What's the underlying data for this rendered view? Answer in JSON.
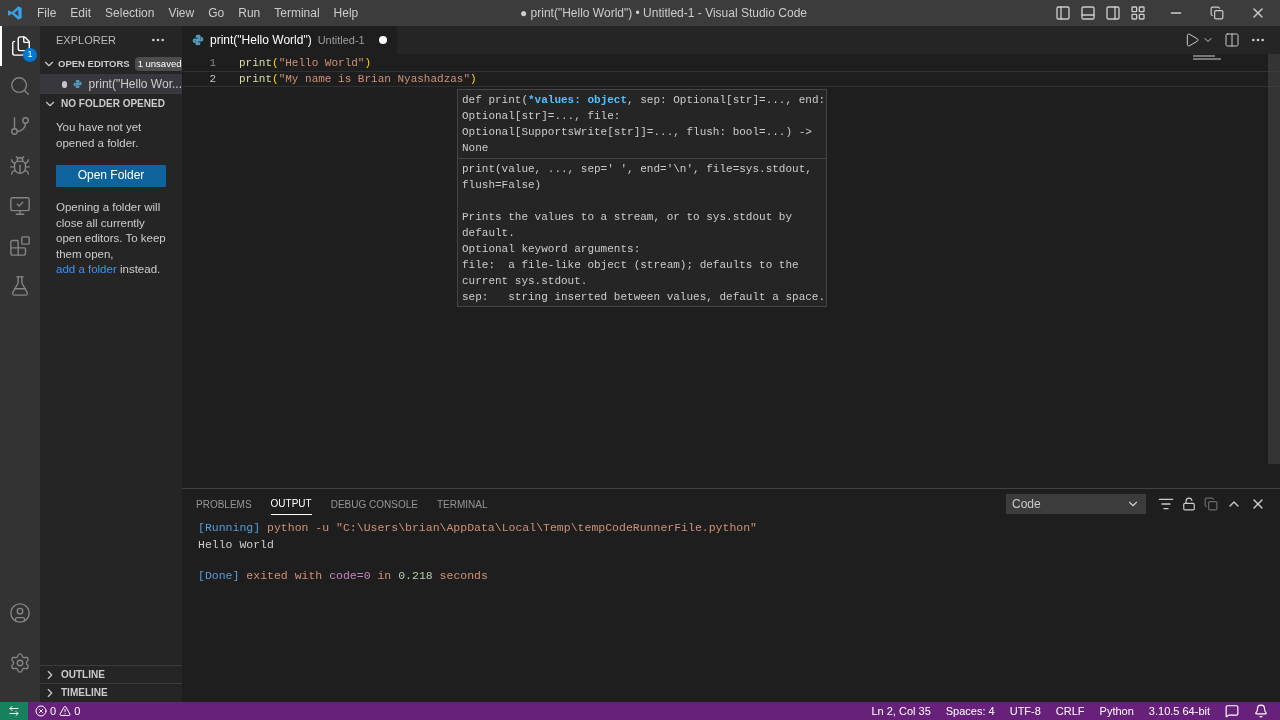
{
  "menu": [
    "File",
    "Edit",
    "Selection",
    "View",
    "Go",
    "Run",
    "Terminal",
    "Help"
  ],
  "window_title": "● print(\"Hello World\") • Untitled-1 - Visual Studio Code",
  "activity_bar": [
    {
      "kind": "files",
      "selected": true,
      "badge": "1"
    },
    {
      "kind": "search",
      "selected": false
    },
    {
      "kind": "source-control",
      "selected": false
    },
    {
      "kind": "run",
      "selected": false
    },
    {
      "kind": "remote",
      "selected": false
    },
    {
      "kind": "extensions",
      "selected": false
    },
    {
      "kind": "testing",
      "selected": false
    }
  ],
  "activity_bottom": [
    {
      "kind": "account"
    },
    {
      "kind": "settings"
    }
  ],
  "sidebar": {
    "title": "EXPLORER",
    "open_editors": {
      "label": "OPEN EDITORS",
      "expanded": true,
      "badge": "1 unsaved",
      "files": [
        {
          "name": "print(\"Hello Wor...",
          "modified": true
        }
      ]
    },
    "no_folder": {
      "label": "NO FOLDER OPENED",
      "expanded": true,
      "message": "You have not yet opened a folder.",
      "button": "Open Folder",
      "note_before": "Opening a folder will close all currently open editors. To keep them open,",
      "link": "add a folder",
      "note_after": "instead."
    },
    "outline": {
      "label": "OUTLINE",
      "expanded": false
    },
    "timeline": {
      "label": "TIMELINE",
      "expanded": false
    }
  },
  "editor_tab": {
    "title": "print(\"Hello World\")",
    "description": "Untitled-1",
    "modified": true,
    "selected": true
  },
  "code_lines": [
    {
      "number": "1",
      "cursor": false,
      "tokens": [
        {
          "text": "print",
          "kind": "func"
        },
        {
          "text": "(",
          "kind": "punct"
        },
        {
          "text": "\"Hello World\"",
          "kind": "string"
        },
        {
          "text": ")",
          "kind": "punct"
        }
      ]
    },
    {
      "number": "2",
      "cursor": true,
      "tokens": [
        {
          "text": "print",
          "kind": "func"
        },
        {
          "text": "(",
          "kind": "punct"
        },
        {
          "text": "\"My name is Brian Nyashadzas",
          "kind": "string"
        },
        {
          "text": "\"",
          "kind": "string"
        },
        {
          "text": ")",
          "kind": "punct"
        }
      ]
    }
  ],
  "hover": {
    "signature": [
      [
        {
          "text": "def print(",
          "active": false
        },
        {
          "text": "*values: object",
          "active": true
        },
        {
          "text": ", sep: Optional[str]=..., end:",
          "active": false
        }
      ],
      [
        {
          "text": "Optional[str]=..., file:",
          "active": false
        }
      ],
      [
        {
          "text": "Optional[SupportsWrite[str]]=..., flush: bool=...) ->",
          "active": false
        }
      ],
      [
        {
          "text": "None",
          "active": false
        }
      ]
    ],
    "doc": [
      [
        "print(value, ..., sep=' ', end='\\n', file=sys.stdout,",
        "flush=False)"
      ],
      [
        "Prints the values to a stream, or to sys.stdout by",
        "default.",
        "Optional keyword arguments:",
        "file:  a file-like object (stream); defaults to the",
        "current sys.stdout.",
        "sep:   string inserted between values, default a space."
      ]
    ]
  },
  "panel": {
    "tabs": [
      {
        "label": "PROBLEMS",
        "selected": false
      },
      {
        "label": "OUTPUT",
        "selected": true
      },
      {
        "label": "DEBUG CONSOLE",
        "selected": false
      },
      {
        "label": "TERMINAL",
        "selected": false
      }
    ],
    "channel": "Code",
    "output": [
      [
        {
          "tokens": [
            {
              "text": "[Running]",
              "kind": "tag"
            },
            {
              "text": " python -u \"C:\\Users\\brian\\AppData\\Local\\Temp\\tempCodeRunnerFile.python\"",
              "kind": "string"
            }
          ]
        },
        {
          "tokens": [
            {
              "text": "Hello World",
              "kind": "plain"
            }
          ]
        }
      ],
      [
        {
          "tokens": [
            {
              "text": "[Done]",
              "kind": "tag"
            },
            {
              "text": " exited with ",
              "kind": "string"
            },
            {
              "text": "code=0",
              "kind": "keyword"
            },
            {
              "text": " in ",
              "kind": "string"
            },
            {
              "text": "0.218",
              "kind": "number"
            },
            {
              "text": " seconds",
              "kind": "string"
            }
          ]
        }
      ]
    ]
  },
  "status_bar": {
    "errors": "0",
    "warnings": "0",
    "items": [
      "Ln 2, Col 35",
      "Spaces: 4",
      "UTF-8",
      "CRLF",
      "Python",
      "3.10.5 64-bit"
    ]
  }
}
